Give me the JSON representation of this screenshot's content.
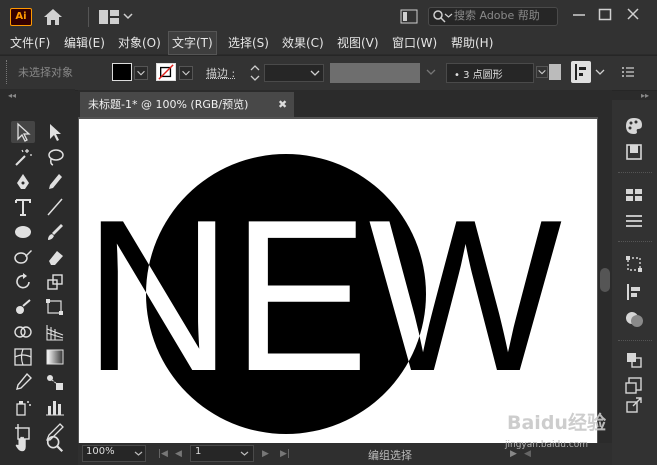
{
  "app": {
    "logo_text": "Ai"
  },
  "search": {
    "placeholder": "搜索 Adobe 帮助"
  },
  "menu": [
    {
      "label": "文件(F)"
    },
    {
      "label": "编辑(E)"
    },
    {
      "label": "对象(O)"
    },
    {
      "label": "文字(T)"
    },
    {
      "label": "选择(S)"
    },
    {
      "label": "效果(C)"
    },
    {
      "label": "视图(V)"
    },
    {
      "label": "窗口(W)"
    },
    {
      "label": "帮助(H)"
    }
  ],
  "control": {
    "no_selection": "未选择对象",
    "stroke_label": "描边 :",
    "brush_value": "•   3  点圆形"
  },
  "document": {
    "tab_title": "未标题-1* @ 100% (RGB/预览)",
    "close_glyph": "✖"
  },
  "artwork": {
    "text": "NEW",
    "text_color": "#000000",
    "circle_color": "#000000",
    "knockout_color": "#ffffff"
  },
  "status": {
    "zoom": "100%",
    "page": "1",
    "tool_text": "编组选择"
  },
  "watermark": {
    "brand": "Baidu经验",
    "sub": "jingyan.baidu.com"
  },
  "colors": {
    "accent": "#ff9a00",
    "ui_bg": "#2b2b2b",
    "panel": "#323232"
  }
}
